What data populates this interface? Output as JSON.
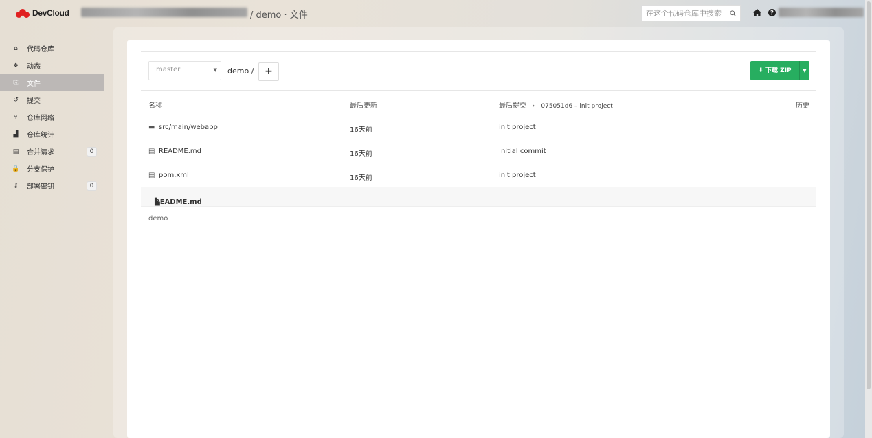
{
  "topbar": {
    "brand": "DevCloud",
    "page_title": "/ demo · 文件",
    "search_placeholder": "在这个代码仓库中搜索",
    "home_icon": "home-icon",
    "help_icon": "help-icon"
  },
  "sidebar": {
    "items": [
      {
        "label": "代码仓库",
        "icon": "home-icon",
        "glyph": "⌂",
        "active": false
      },
      {
        "label": "动态",
        "icon": "activity-icon",
        "glyph": "❖",
        "active": false
      },
      {
        "label": "文件",
        "icon": "files-icon",
        "glyph": "⎘",
        "active": true
      },
      {
        "label": "提交",
        "icon": "history-icon",
        "glyph": "↺",
        "active": false
      },
      {
        "label": "仓库网络",
        "icon": "network-icon",
        "glyph": "⑂",
        "active": false
      },
      {
        "label": "仓库统计",
        "icon": "chart-icon",
        "glyph": "▟",
        "active": false
      },
      {
        "label": "合并请求",
        "icon": "merge-icon",
        "glyph": "▤",
        "active": false,
        "badge": "0"
      },
      {
        "label": "分支保护",
        "icon": "lock-icon",
        "glyph": "🔒",
        "active": false
      },
      {
        "label": "部署密钥",
        "icon": "key-icon",
        "glyph": "⚷",
        "active": false,
        "badge": "0"
      }
    ]
  },
  "toolbar": {
    "branch": "master",
    "path": "demo  /",
    "add_label": "+",
    "zip_label": "下载 ZIP"
  },
  "table": {
    "headers": {
      "name": "名称",
      "updated": "最后更新",
      "last_commit": "最后提交",
      "commit_info": "075051d6 – init project",
      "history": "历史"
    },
    "rows": [
      {
        "type": "folder",
        "name": "src/main/webapp",
        "updated": "16天前",
        "commit": "init project"
      },
      {
        "type": "file",
        "name": "README.md",
        "updated": "16天前",
        "commit": "Initial commit"
      },
      {
        "type": "file",
        "name": "pom.xml",
        "updated": "16天前",
        "commit": "init project"
      }
    ]
  },
  "readme": {
    "title": "README.md",
    "content": "demo"
  }
}
